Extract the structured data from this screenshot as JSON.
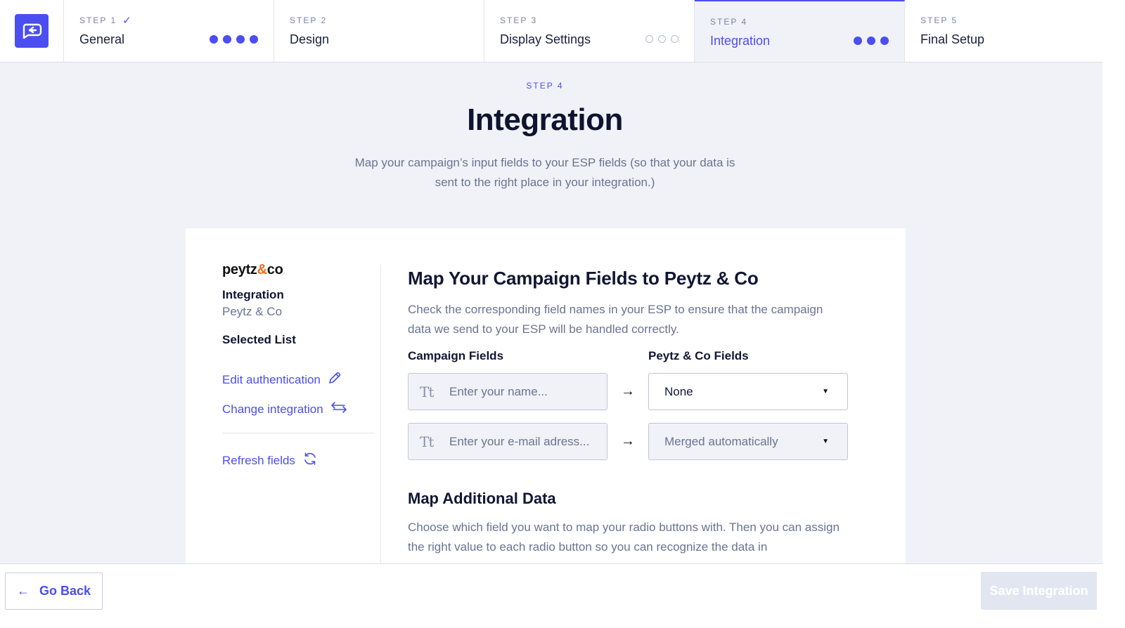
{
  "stepper": {
    "steps": [
      {
        "label": "STEP 1",
        "name": "General",
        "check": "✓",
        "dots": "filled-4"
      },
      {
        "label": "STEP 2",
        "name": "Design"
      },
      {
        "label": "STEP 3",
        "name": "Display Settings",
        "dots": "empty-3"
      },
      {
        "label": "STEP 4",
        "name": "Integration",
        "dots": "filled-3",
        "active": true
      },
      {
        "label": "STEP 5",
        "name": "Final Setup"
      }
    ]
  },
  "header": {
    "eyebrow": "STEP 4",
    "title": "Integration",
    "subtitle": "Map your campaign’s input fields to your ESP fields (so that your data is sent to the right place in your integration.)"
  },
  "sidebar": {
    "brand_prefix": "peytz",
    "brand_amp": "&",
    "brand_suffix": "co",
    "integration_label": "Integration",
    "integration_value": "Peytz & Co",
    "selected_list_label": "Selected List",
    "edit_auth": "Edit authentication",
    "change_integration": "Change integration",
    "refresh_fields": "Refresh fields"
  },
  "mapping": {
    "title": "Map Your Campaign Fields to Peytz & Co",
    "description": "Check the corresponding field names in your ESP to ensure that the campaign data we send to your ESP will be handled correctly.",
    "campaign_fields_header": "Campaign Fields",
    "esp_fields_header": "Peytz & Co Fields",
    "rows": [
      {
        "placeholder": "Enter your name...",
        "select_value": "None",
        "tt": "Tt",
        "arrow": "→"
      },
      {
        "placeholder": "Enter your e-mail adress...",
        "select_value": "Merged automatically",
        "tt": "Tt",
        "arrow": "→"
      }
    ]
  },
  "additional": {
    "title": "Map Additional Data",
    "description": "Choose which field you want to map your radio buttons with. Then you can assign the right value to each radio button so you can recognize the data in"
  },
  "footer": {
    "go_back": "Go Back",
    "back_arrow": "←",
    "save": "Save Integration"
  },
  "colors": {
    "accent": "#4b4ef0",
    "brand_amp": "#f26a1b",
    "background": "#f1f2f7"
  }
}
